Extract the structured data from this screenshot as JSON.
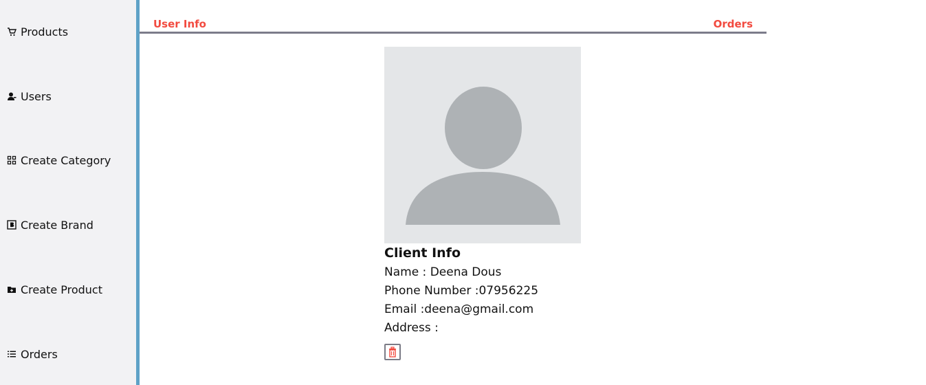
{
  "sidebar": {
    "items": [
      {
        "label": "Products",
        "icon": "cart-icon"
      },
      {
        "label": "Users",
        "icon": "user-icon"
      },
      {
        "label": "Create Category",
        "icon": "grid-icon"
      },
      {
        "label": "Create Brand",
        "icon": "brand-icon"
      },
      {
        "label": "Create Product",
        "icon": "folder-plus-icon"
      },
      {
        "label": "Orders",
        "icon": "list-icon"
      }
    ],
    "border_color": "#5fa2c7",
    "background": "#f2f2f4"
  },
  "tabs": {
    "user_info": "User Info",
    "orders": "Orders",
    "accent_color": "#f24a3f"
  },
  "client": {
    "title": "Client Info",
    "name": "Name : Deena Dous",
    "phone": "Phone Number :07956225",
    "email": "Email :deena@gmail.com",
    "address": "Address :"
  },
  "actions": {
    "delete_icon": "trash-icon",
    "delete_color": "#f24a3f"
  }
}
